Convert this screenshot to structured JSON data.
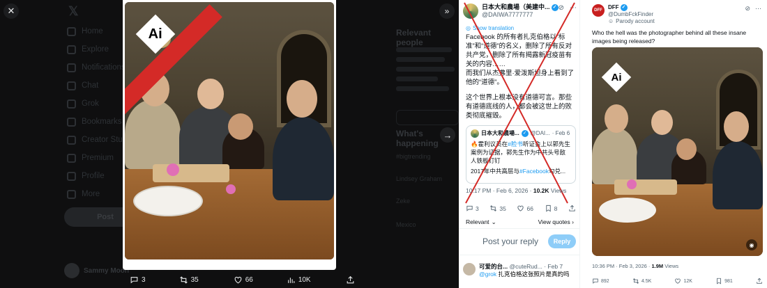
{
  "viewer": {
    "nav": [
      "Home",
      "Explore",
      "Notifications",
      "Chat",
      "Grok",
      "Bookmarks",
      "Creator Studio",
      "Premium",
      "Profile",
      "More"
    ],
    "post_label": "Post",
    "profile_name": "Sammy Moon",
    "right_sidebar": {
      "relevant_header": "Relevant people",
      "happening_header": "What's happening",
      "trend_lines": [
        "#bigtrending",
        "Lindsey Graham",
        "Zeke",
        "Mexico"
      ]
    },
    "ai_label": "Ai",
    "actions": {
      "replies": "3",
      "reposts": "35",
      "likes": "66",
      "views": "10K"
    }
  },
  "middle_tweet": {
    "name": "日本大和農場（美建中...",
    "handle": "@DAIWA7777777",
    "translation": "Show translation",
    "body": [
      "Facebook 的所有者扎克伯格以“标准”和“道德”的名义，删除了所有反对共产党，删除了所有揭露新冠疫苗有关的内容……",
      "而我们从杰弗里·爱泼斯坦身上看到了他的“道德”。",
      "",
      "这个世界上根本没有道德可言。那些有道德底线的人，都会被这世上的败类彻底摧毁。"
    ],
    "quote": {
      "name": "日本大和農場...",
      "handle": "@DAI...",
      "date": "· Feb 6",
      "text_pre": "🔥霍利议员在",
      "hashtag1": "#脸书",
      "text_mid": "听证会上以郭先生案例为证据，郭先生作为中共头号敌人铁板钉钉",
      "line2_pre": "2017年中共高层与",
      "hashtag2": "#Facebook",
      "line2_post": "勾兑..."
    },
    "timestamp": "10:17 PM · Feb 6, 2026 · ",
    "views": "10.2K",
    "views_label": " Views",
    "actions": {
      "replies": "3",
      "reposts": "35",
      "likes": "66",
      "bookmarks": "8"
    },
    "relevant": "Relevant",
    "view_quotes": "View quotes",
    "reply_placeholder": "Post your reply",
    "reply_button": "Reply",
    "reply": {
      "name": "可爱的台...",
      "handle": "@cuteRud... · Feb 7",
      "mention": "@grok",
      "text": " 扎克伯格这张照片是真的吗"
    }
  },
  "right_tweet": {
    "name": "DFF",
    "handle": "@DumbFckFinder",
    "parody": "Parody account",
    "avatar_text": "DFF",
    "body": "Who the hell was the photographer behind all these insane images being released?",
    "ai_label": "Ai",
    "timestamp": "10:36 PM · Feb 3, 2026 · ",
    "views": "1.9M",
    "views_label": " Views",
    "actions": {
      "replies": "892",
      "reposts": "4.5K",
      "likes": "12K",
      "bookmarks": "981"
    }
  },
  "colors": {
    "accent": "#1d9bf0",
    "strike": "#d42a27",
    "reply_button": "#8ecdf8"
  }
}
